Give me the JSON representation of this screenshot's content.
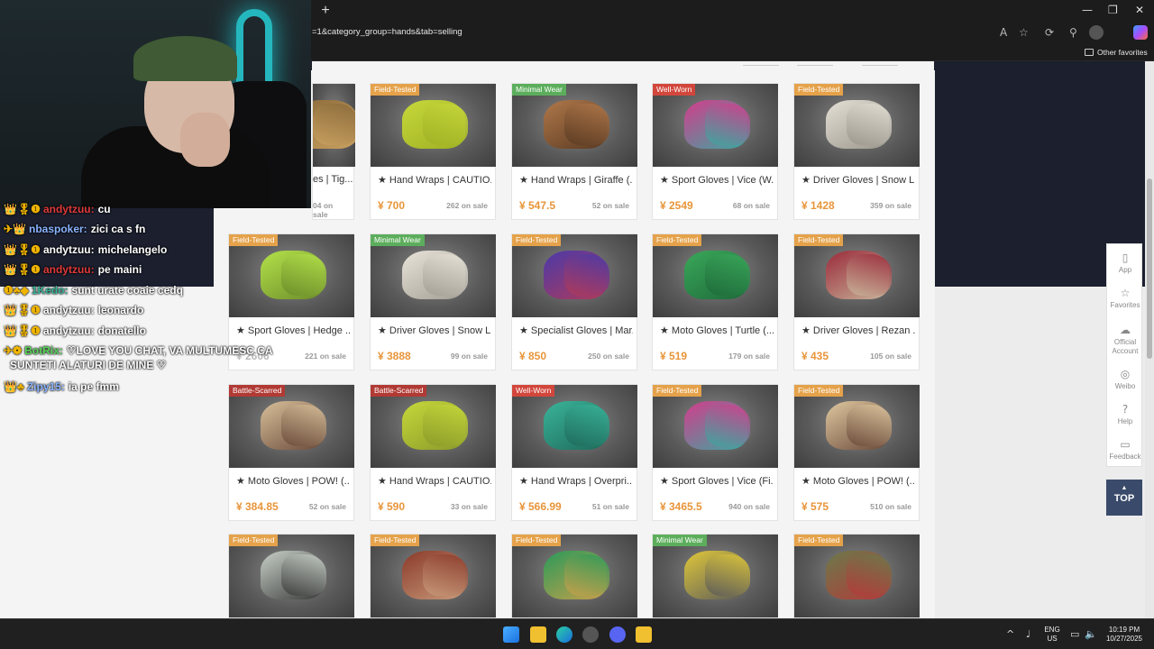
{
  "browser": {
    "url": "=1&category_group=hands&tab=selling",
    "other_favorites": "Other favorites",
    "new_tab_symbol": "+",
    "window_controls": [
      "—",
      "❐",
      "✕"
    ]
  },
  "cards": [
    {
      "wear": "",
      "wear_type": "ft",
      "name": "es | Tig...",
      "price": "",
      "sale": "04 on sale",
      "colors": [
        "#8a6a3a",
        "#c8a060"
      ]
    },
    {
      "wear": "Field-Tested",
      "wear_type": "ft",
      "name": "★ Hand Wraps | CAUTIO...",
      "price": "¥ 700",
      "sale": "262 on sale",
      "colors": [
        "#c6d83a",
        "#9fb024"
      ]
    },
    {
      "wear": "Minimal Wear",
      "wear_type": "mw",
      "name": "★ Hand Wraps | Giraffe (...",
      "price": "¥ 547.5",
      "sale": "52 on sale",
      "colors": [
        "#b0784a",
        "#5a3a22"
      ]
    },
    {
      "wear": "Well-Worn",
      "wear_type": "ww",
      "name": "★ Sport Gloves | Vice (W...",
      "price": "¥ 2549",
      "sale": "68 on sale",
      "colors": [
        "#d43c8c",
        "#3aa8a0"
      ]
    },
    {
      "wear": "Field-Tested",
      "wear_type": "ft",
      "name": "★ Driver Gloves | Snow L...",
      "price": "¥ 1428",
      "sale": "359 on sale",
      "colors": [
        "#e4e0d6",
        "#9a968c"
      ]
    },
    {
      "wear": "Field-Tested",
      "wear_type": "ft",
      "name": "★ Sport Gloves | Hedge ...",
      "price": "¥ 2606",
      "sale": "221 on sale",
      "colors": [
        "#b4e24a",
        "#6c8c2a"
      ]
    },
    {
      "wear": "Minimal Wear",
      "wear_type": "mw",
      "name": "★ Driver Gloves | Snow L...",
      "price": "¥ 3888",
      "sale": "99 on sale",
      "colors": [
        "#e8e4da",
        "#a29e94"
      ]
    },
    {
      "wear": "Field-Tested",
      "wear_type": "ft",
      "name": "★ Specialist Gloves | Mar...",
      "price": "¥ 850",
      "sale": "250 on sale",
      "colors": [
        "#4a3aa8",
        "#b03a5a"
      ]
    },
    {
      "wear": "Field-Tested",
      "wear_type": "ft",
      "name": "★ Moto Gloves | Turtle (...",
      "price": "¥ 519",
      "sale": "179 on sale",
      "colors": [
        "#3aa85a",
        "#1e6a3a"
      ]
    },
    {
      "wear": "Field-Tested",
      "wear_type": "ft",
      "name": "★ Driver Gloves | Rezan ...",
      "price": "¥ 435",
      "sale": "105 on sale",
      "colors": [
        "#9a2a3a",
        "#c8b49a"
      ]
    },
    {
      "wear": "Battle-Scarred",
      "wear_type": "bs",
      "name": "★ Moto Gloves | POW! (...",
      "price": "¥ 384.85",
      "sale": "52 on sale",
      "colors": [
        "#d8c09a",
        "#6a4a3a"
      ]
    },
    {
      "wear": "Battle-Scarred",
      "wear_type": "bs",
      "name": "★ Hand Wraps | CAUTIO...",
      "price": "¥ 590",
      "sale": "33 on sale",
      "colors": [
        "#c6d83a",
        "#8a9a2a"
      ]
    },
    {
      "wear": "Well-Worn",
      "wear_type": "ww",
      "name": "★ Hand Wraps | Overpri...",
      "price": "¥ 566.99",
      "sale": "51 on sale",
      "colors": [
        "#3ab49a",
        "#1e6a5a"
      ]
    },
    {
      "wear": "Field-Tested",
      "wear_type": "ft",
      "name": "★ Sport Gloves | Vice (Fi...",
      "price": "¥ 3465.5",
      "sale": "940 on sale",
      "colors": [
        "#d43c8c",
        "#3aa8a0"
      ]
    },
    {
      "wear": "Field-Tested",
      "wear_type": "ft",
      "name": "★ Moto Gloves | POW! (...",
      "price": "¥ 575",
      "sale": "510 on sale",
      "colors": [
        "#e0c8a0",
        "#6a4a3a"
      ]
    },
    {
      "wear": "Field-Tested",
      "wear_type": "ft",
      "name": "",
      "price": "",
      "sale": "",
      "colors": [
        "#c8d0c8",
        "#3a3a3a"
      ]
    },
    {
      "wear": "Field-Tested",
      "wear_type": "ft",
      "name": "",
      "price": "",
      "sale": "",
      "colors": [
        "#8a3a2a",
        "#c89a7a"
      ]
    },
    {
      "wear": "Field-Tested",
      "wear_type": "ft",
      "name": "",
      "price": "",
      "sale": "",
      "colors": [
        "#2a9a5a",
        "#c8a04a"
      ]
    },
    {
      "wear": "Minimal Wear",
      "wear_type": "mw",
      "name": "",
      "price": "",
      "sale": "",
      "colors": [
        "#e0c83a",
        "#5a5a5a"
      ]
    },
    {
      "wear": "Field-Tested",
      "wear_type": "ft",
      "name": "",
      "price": "",
      "sale": "",
      "colors": [
        "#6a7a4a",
        "#b43a3a"
      ]
    }
  ],
  "sidebar": [
    {
      "icon": "▯",
      "label": "App",
      "name": "app"
    },
    {
      "icon": "☆",
      "label": "Favorites",
      "name": "favorites"
    },
    {
      "icon": "☁",
      "label": "Official Account",
      "name": "official-account"
    },
    {
      "icon": "◎",
      "label": "Weibo",
      "name": "weibo"
    },
    {
      "icon": "?",
      "label": "Help",
      "name": "help"
    },
    {
      "icon": "▭",
      "label": "Feedback",
      "name": "feedback"
    }
  ],
  "top_button": {
    "arrow": "▲",
    "label": "TOP"
  },
  "chat": [
    {
      "badges": "👑🎖❶",
      "user": "andytzuu:",
      "user_color": "#e03a3a",
      "msg": "cu"
    },
    {
      "badges": "✈👑",
      "user": "nbaspoker:",
      "user_color": "#8ab4ff",
      "msg": "zici ca s fn"
    },
    {
      "badges": "👑🎖❶",
      "user": "andytzuu:",
      "user_color": "#ffffff",
      "msg": "michelangelo"
    },
    {
      "badges": "👑🎖❶",
      "user": "andytzuu:",
      "user_color": "#e03a3a",
      "msg": "pe maini"
    },
    {
      "badges": "❶♣◆",
      "user": "1Kedo:",
      "user_color": "#3ab49a",
      "msg": "sunt urate coaie cedq"
    },
    {
      "badges": "👑🎖❶",
      "user": "andytzuu:",
      "user_color": "#ffffff",
      "msg": "leonardo"
    },
    {
      "badges": "👑🎖❶",
      "user": "andytzuu:",
      "user_color": "#ffffff",
      "msg": "donatello"
    },
    {
      "badges": "✈❁",
      "user": "BotRix:",
      "user_color": "#5ad85a",
      "msg": "♡LOVE YOU CHAT, VA MULTUMESC CA"
    },
    {
      "badges": "",
      "user": "",
      "user_color": "#ffffff",
      "msg": "SUNTETI ALATURI DE MINE ♡"
    },
    {
      "badges": "👑♣",
      "user": "Zipy15:",
      "user_color": "#8ab4ff",
      "msg": "ia pe fmm"
    }
  ],
  "taskbar": {
    "lang": "ENG",
    "region": "US",
    "time": "10:19 PM",
    "date": "10/27/2025"
  }
}
